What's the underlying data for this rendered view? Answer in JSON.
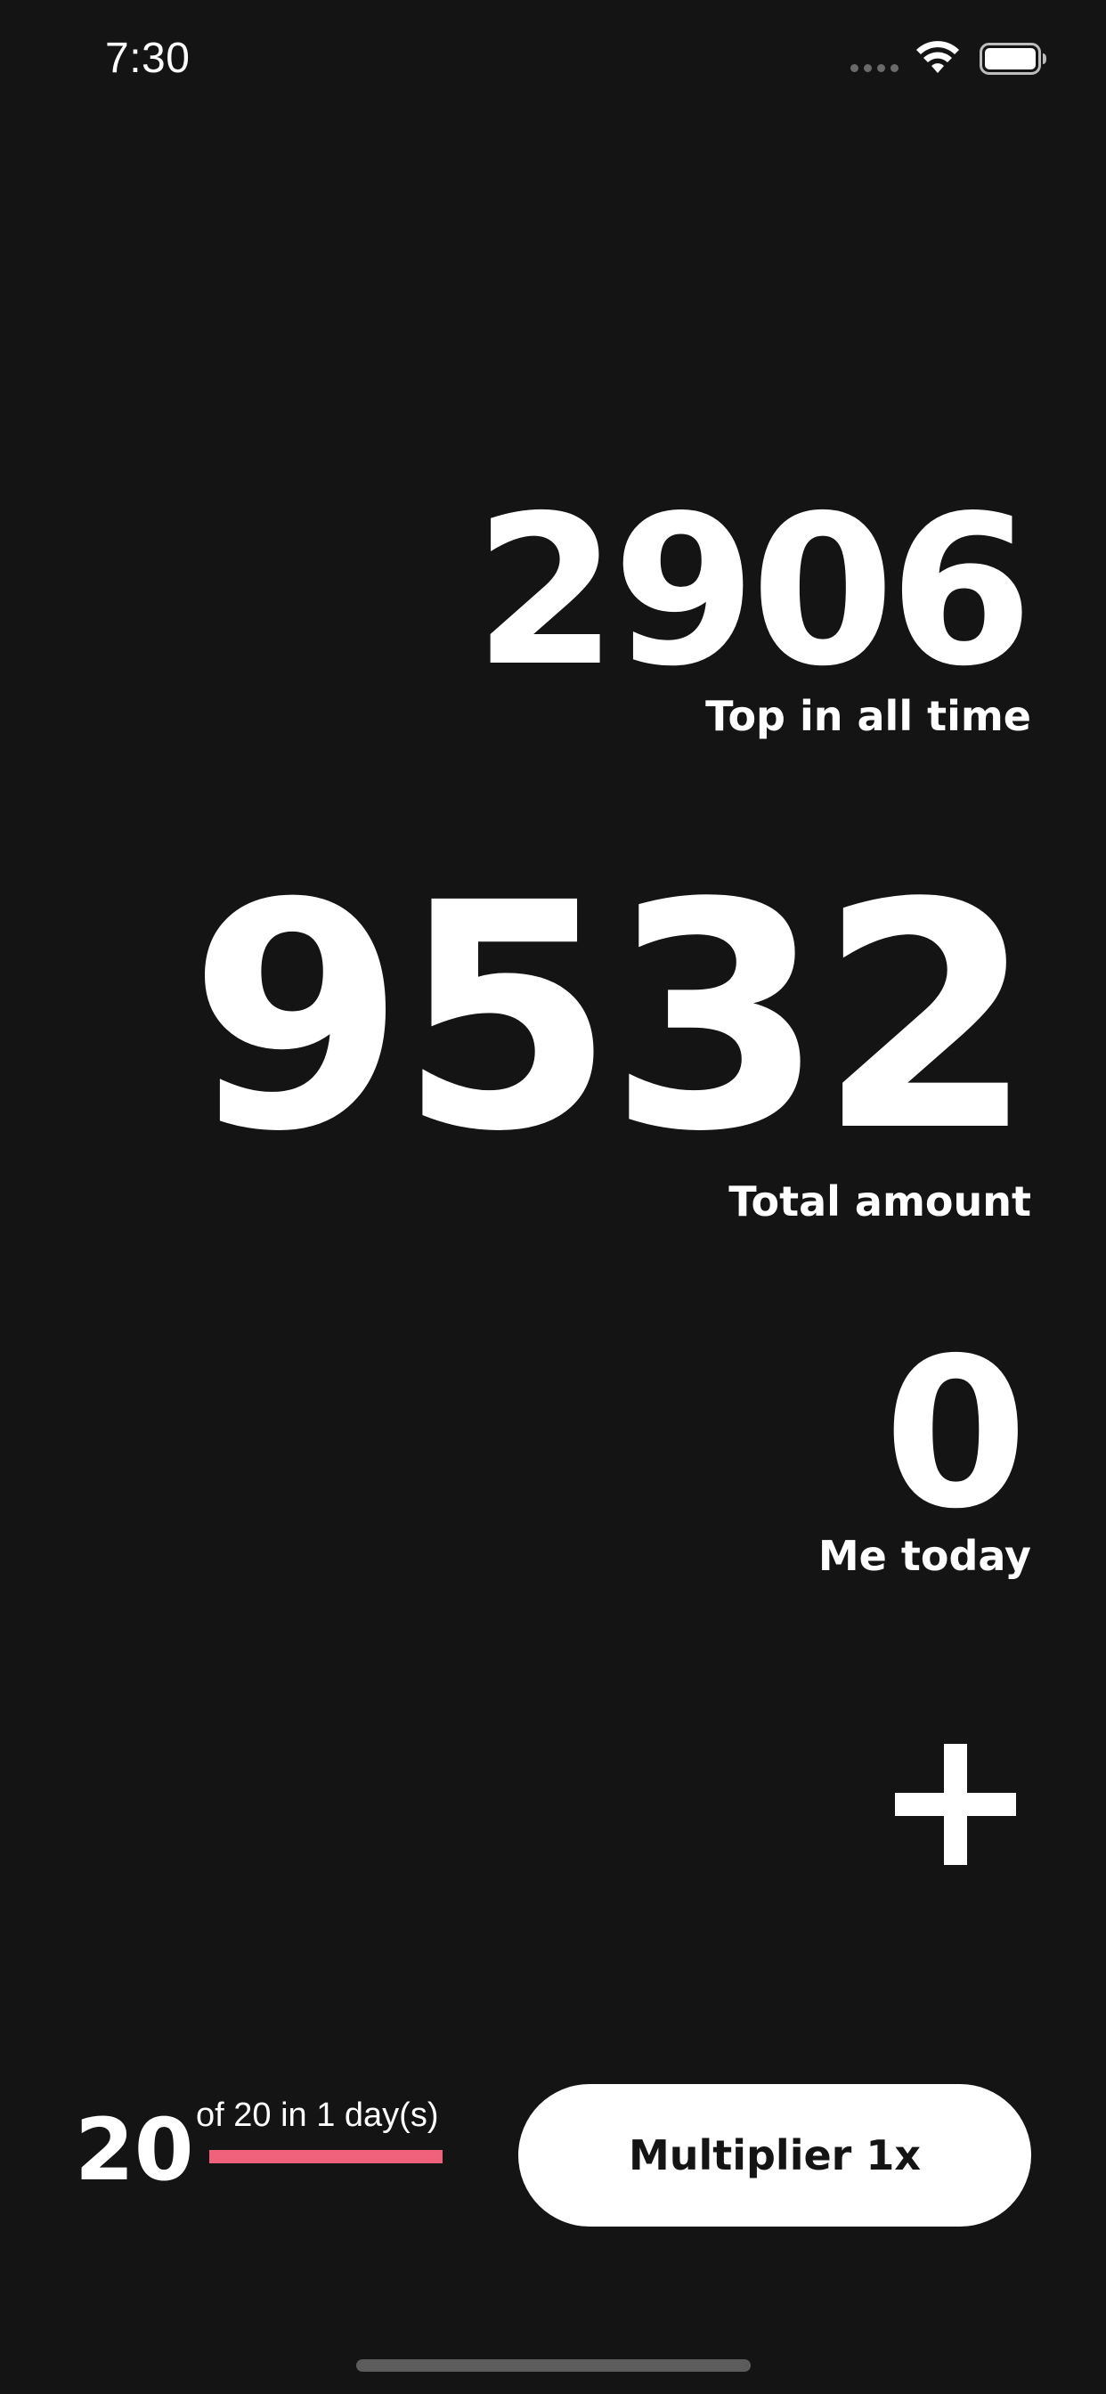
{
  "status_bar": {
    "time": "7:30",
    "icons": [
      "signal-icon",
      "wifi-icon",
      "battery-icon"
    ]
  },
  "stats": {
    "top_all_time": {
      "value": "2906",
      "label": "Top in all time"
    },
    "total_amount": {
      "value": "9532",
      "label": "Total amount"
    },
    "me_today": {
      "value": "0",
      "label": "Me today"
    }
  },
  "add_button": {
    "icon": "plus-icon"
  },
  "quota": {
    "count": "20",
    "text": "of 20 in 1 day(s)",
    "progress_fraction": 1.0,
    "bar_color": "#f0617b"
  },
  "multiplier": {
    "label": "Multiplier 1x"
  },
  "colors": {
    "background": "#141414",
    "foreground": "#ffffff",
    "accent": "#f0617b"
  }
}
